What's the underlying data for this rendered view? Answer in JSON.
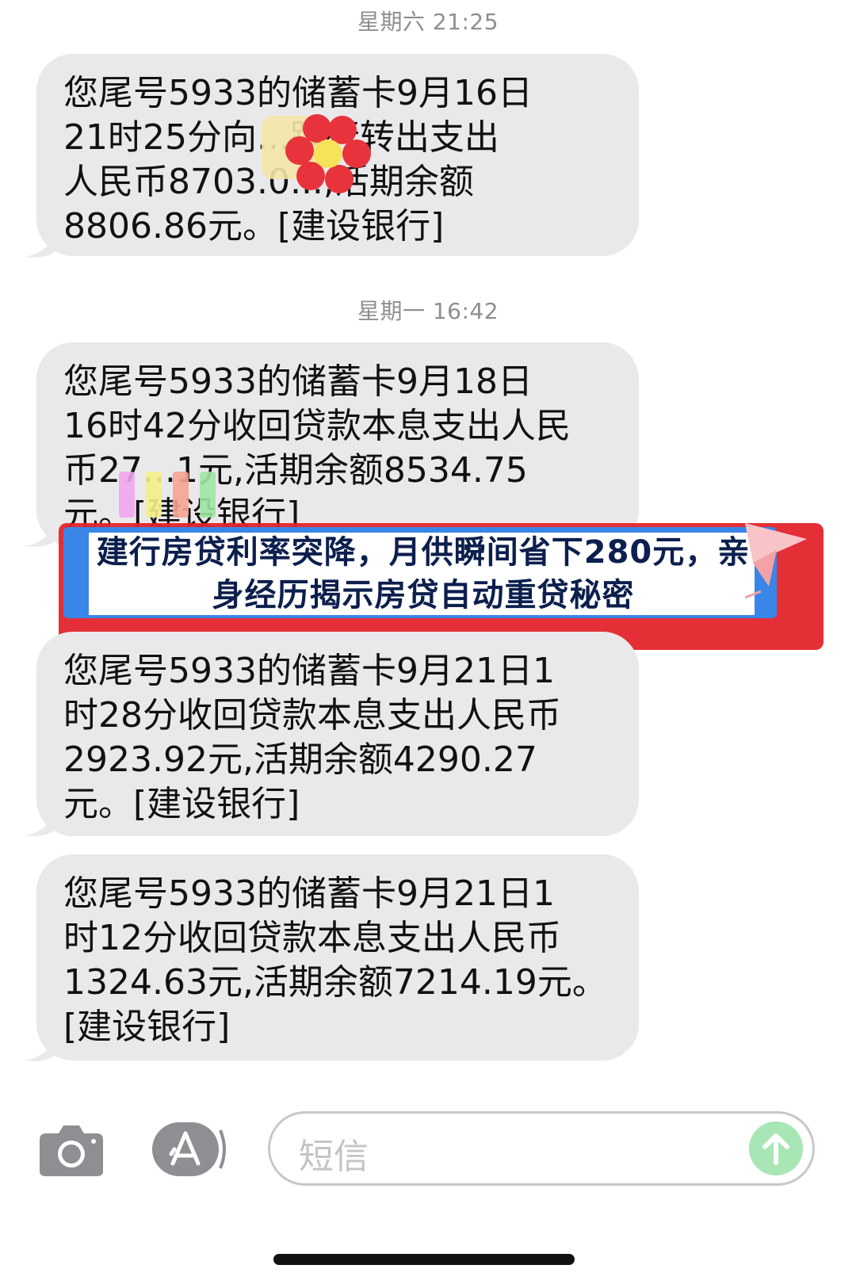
{
  "conversation": {
    "timestamps": [
      "星期六 21:25",
      "星期一 16:42"
    ],
    "messages": [
      "您尾号5933的储蓄卡9月16日\n21时25分向...跨行转出支出\n人民币8703.0...,活期余额\n8806.86元。[建设银行]",
      "您尾号5933的储蓄卡9月18日\n16时42分收回贷款本息支出人民\n币27...1元,活期余额8534.75\n元。[建设银行]",
      "您尾号5933的储蓄卡9月21日1\n时28分收回贷款本息支出人民币\n2923.92元,活期余额4290.27\n元。[建设银行]",
      "您尾号5933的储蓄卡9月21日1\n时12分收回贷款本息支出人民币\n1324.63元,活期余额7214.19元。\n[建设银行]"
    ]
  },
  "overlay": {
    "title": "建行房贷利率突降，月供瞬间省下280元，亲身经历揭示房贷自动重贷秘密"
  },
  "composer": {
    "placeholder": "短信",
    "camera_icon": "camera-icon",
    "apps_icon": "app-store-icon",
    "send_icon": "send-arrow-icon"
  },
  "colors": {
    "bubble": "#e9e9eb",
    "send": "#a8e6b5",
    "banner_blue": "#3a86e8",
    "banner_red": "#e3242b"
  }
}
